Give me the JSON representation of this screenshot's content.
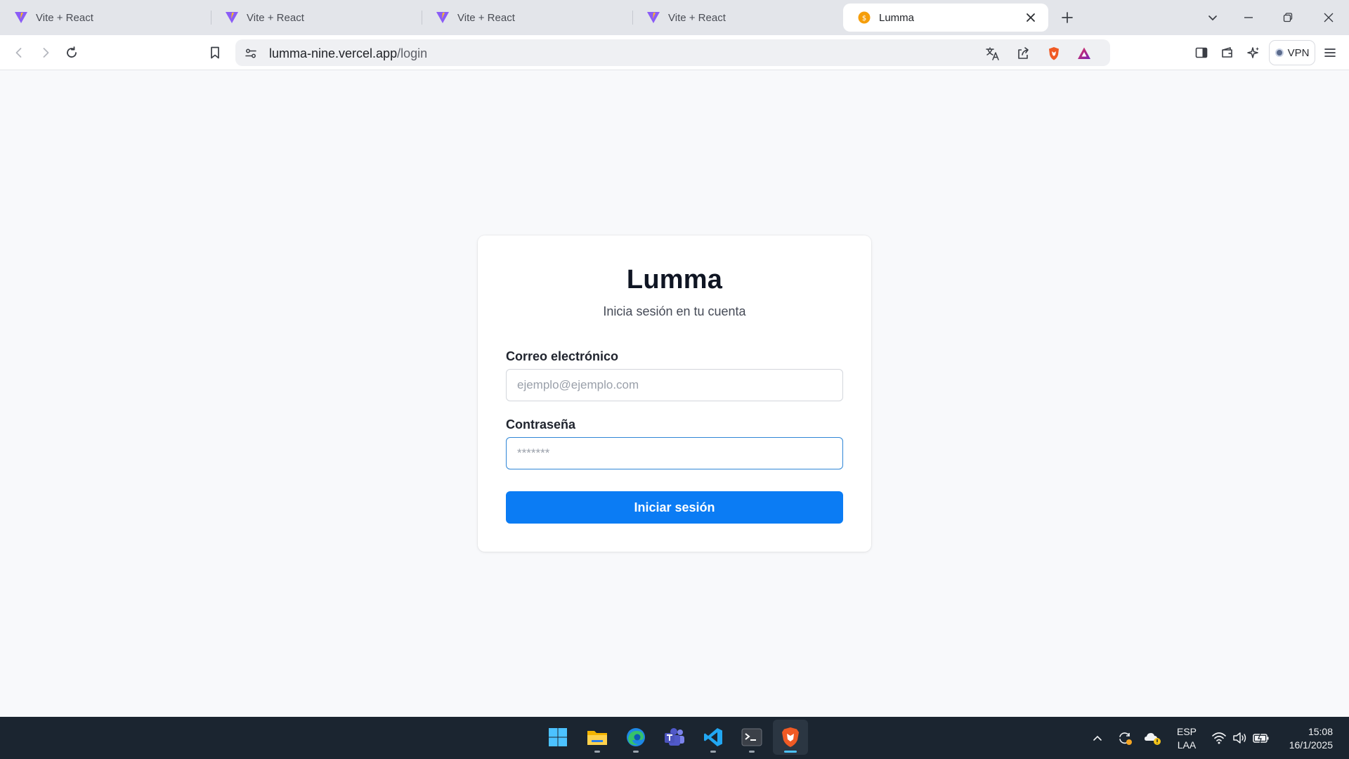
{
  "browser": {
    "tabs": [
      {
        "title": "Vite + React",
        "active": false
      },
      {
        "title": "Vite + React",
        "active": false
      },
      {
        "title": "Vite + React",
        "active": false
      },
      {
        "title": "Vite + React",
        "active": false
      },
      {
        "title": "Lumma",
        "active": true
      }
    ],
    "address": {
      "host": "lumma-nine.vercel.app",
      "path": "/login"
    },
    "vpn_label": "VPN",
    "icons": [
      "back-icon",
      "forward-icon",
      "reload-icon",
      "bookmark-icon",
      "site-settings-icon",
      "translate-icon",
      "share-icon",
      "brave-shields-icon",
      "brave-rewards-icon",
      "sidebar-icon",
      "wallet-icon",
      "leo-ai-icon",
      "menu-icon"
    ]
  },
  "login": {
    "brand": "Lumma",
    "subtitle": "Inicia sesión en tu cuenta",
    "email_label": "Correo electrónico",
    "email_placeholder": "ejemplo@ejemplo.com",
    "password_label": "Contraseña",
    "password_placeholder": "*******",
    "submit_label": "Iniciar sesión"
  },
  "taskbar": {
    "apps": [
      "windows-start",
      "file-explorer",
      "edge",
      "teams",
      "vscode",
      "terminal",
      "brave"
    ],
    "lang_primary": "ESP",
    "lang_secondary": "LAA",
    "time": "15:08",
    "date": "16/1/2025"
  },
  "colors": {
    "accent": "#0b7cf4",
    "focus_ring": "#2f86d6",
    "page_bg": "#f8f9fb",
    "taskbar_bg": "#1b2530"
  }
}
